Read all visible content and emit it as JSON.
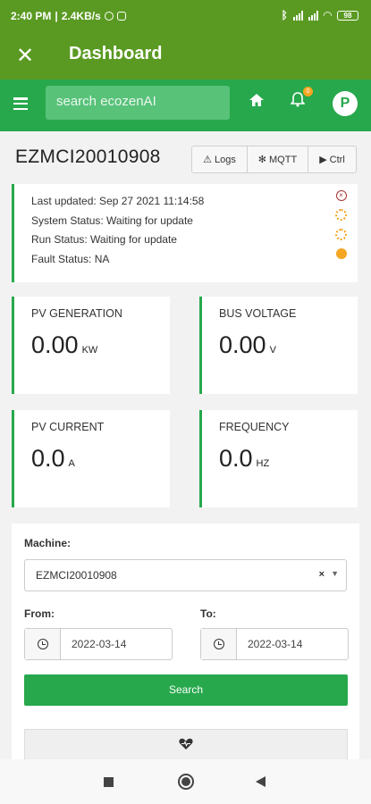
{
  "status_bar": {
    "time": "2:40 PM",
    "speed": "2.4KB/s",
    "battery": "98"
  },
  "app_bar": {
    "title": "Dashboard"
  },
  "navbar": {
    "search_placeholder": "search ecozenAI",
    "notification_count": "0",
    "avatar_letter": "P"
  },
  "device": {
    "id": "EZMCI20010908",
    "buttons": {
      "logs": "Logs",
      "mqtt": "MQTT",
      "ctrl": "Ctrl"
    }
  },
  "status": {
    "last_updated": "Last updated: Sep 27 2021 11:14:58",
    "system_status": "System Status: Waiting for update",
    "run_status": "Run Status: Waiting for update",
    "fault_status": "Fault Status: NA"
  },
  "metrics": [
    {
      "label": "PV GENERATION",
      "value": "0.00",
      "unit": "KW"
    },
    {
      "label": "BUS VOLTAGE",
      "value": "0.00",
      "unit": "V"
    },
    {
      "label": "PV CURRENT",
      "value": "0.0",
      "unit": "A"
    },
    {
      "label": "FREQUENCY",
      "value": "0.0",
      "unit": "HZ"
    }
  ],
  "form": {
    "machine_label": "Machine:",
    "machine_value": "EZMCI20010908",
    "from_label": "From:",
    "from_value": "2022-03-14",
    "to_label": "To:",
    "to_value": "2022-03-14",
    "search_label": "Search"
  },
  "colors": {
    "primary": "#27a84c",
    "appbar": "#5a9a22",
    "warning": "#f5a623"
  }
}
